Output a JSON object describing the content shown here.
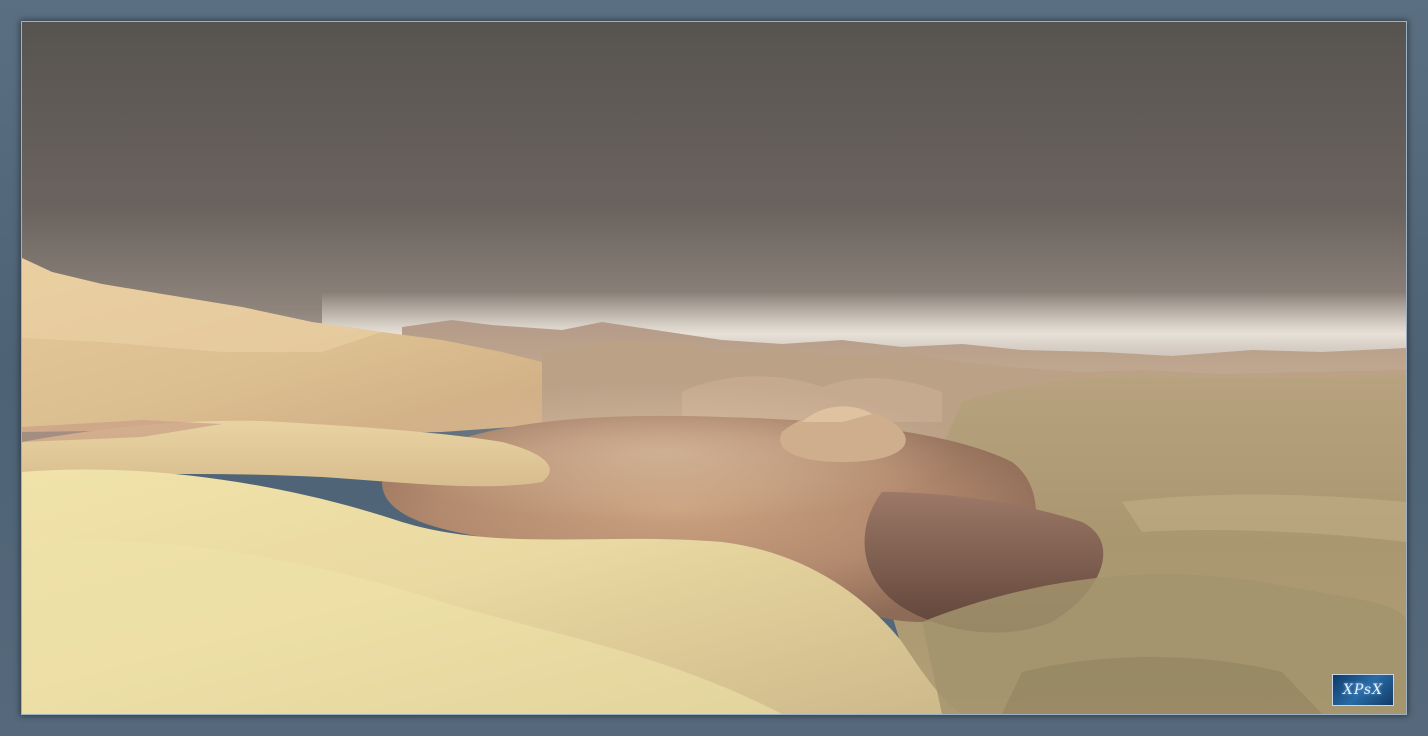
{
  "image": {
    "subject": "",
    "colors": {
      "frame": "#4f6477",
      "sky_top": "#55524e",
      "sky_bottom": "#8a8078",
      "horizon_glow": "#e9e3da",
      "dune_light": "#eedfa6",
      "dune_mid": "#d9bf8a",
      "haze": "#c9a27f",
      "shadow": "#6e5147",
      "grass": "#a99a6c"
    }
  },
  "watermark": {
    "text": "XPsX",
    "icon": "xpsx-logo-icon"
  }
}
